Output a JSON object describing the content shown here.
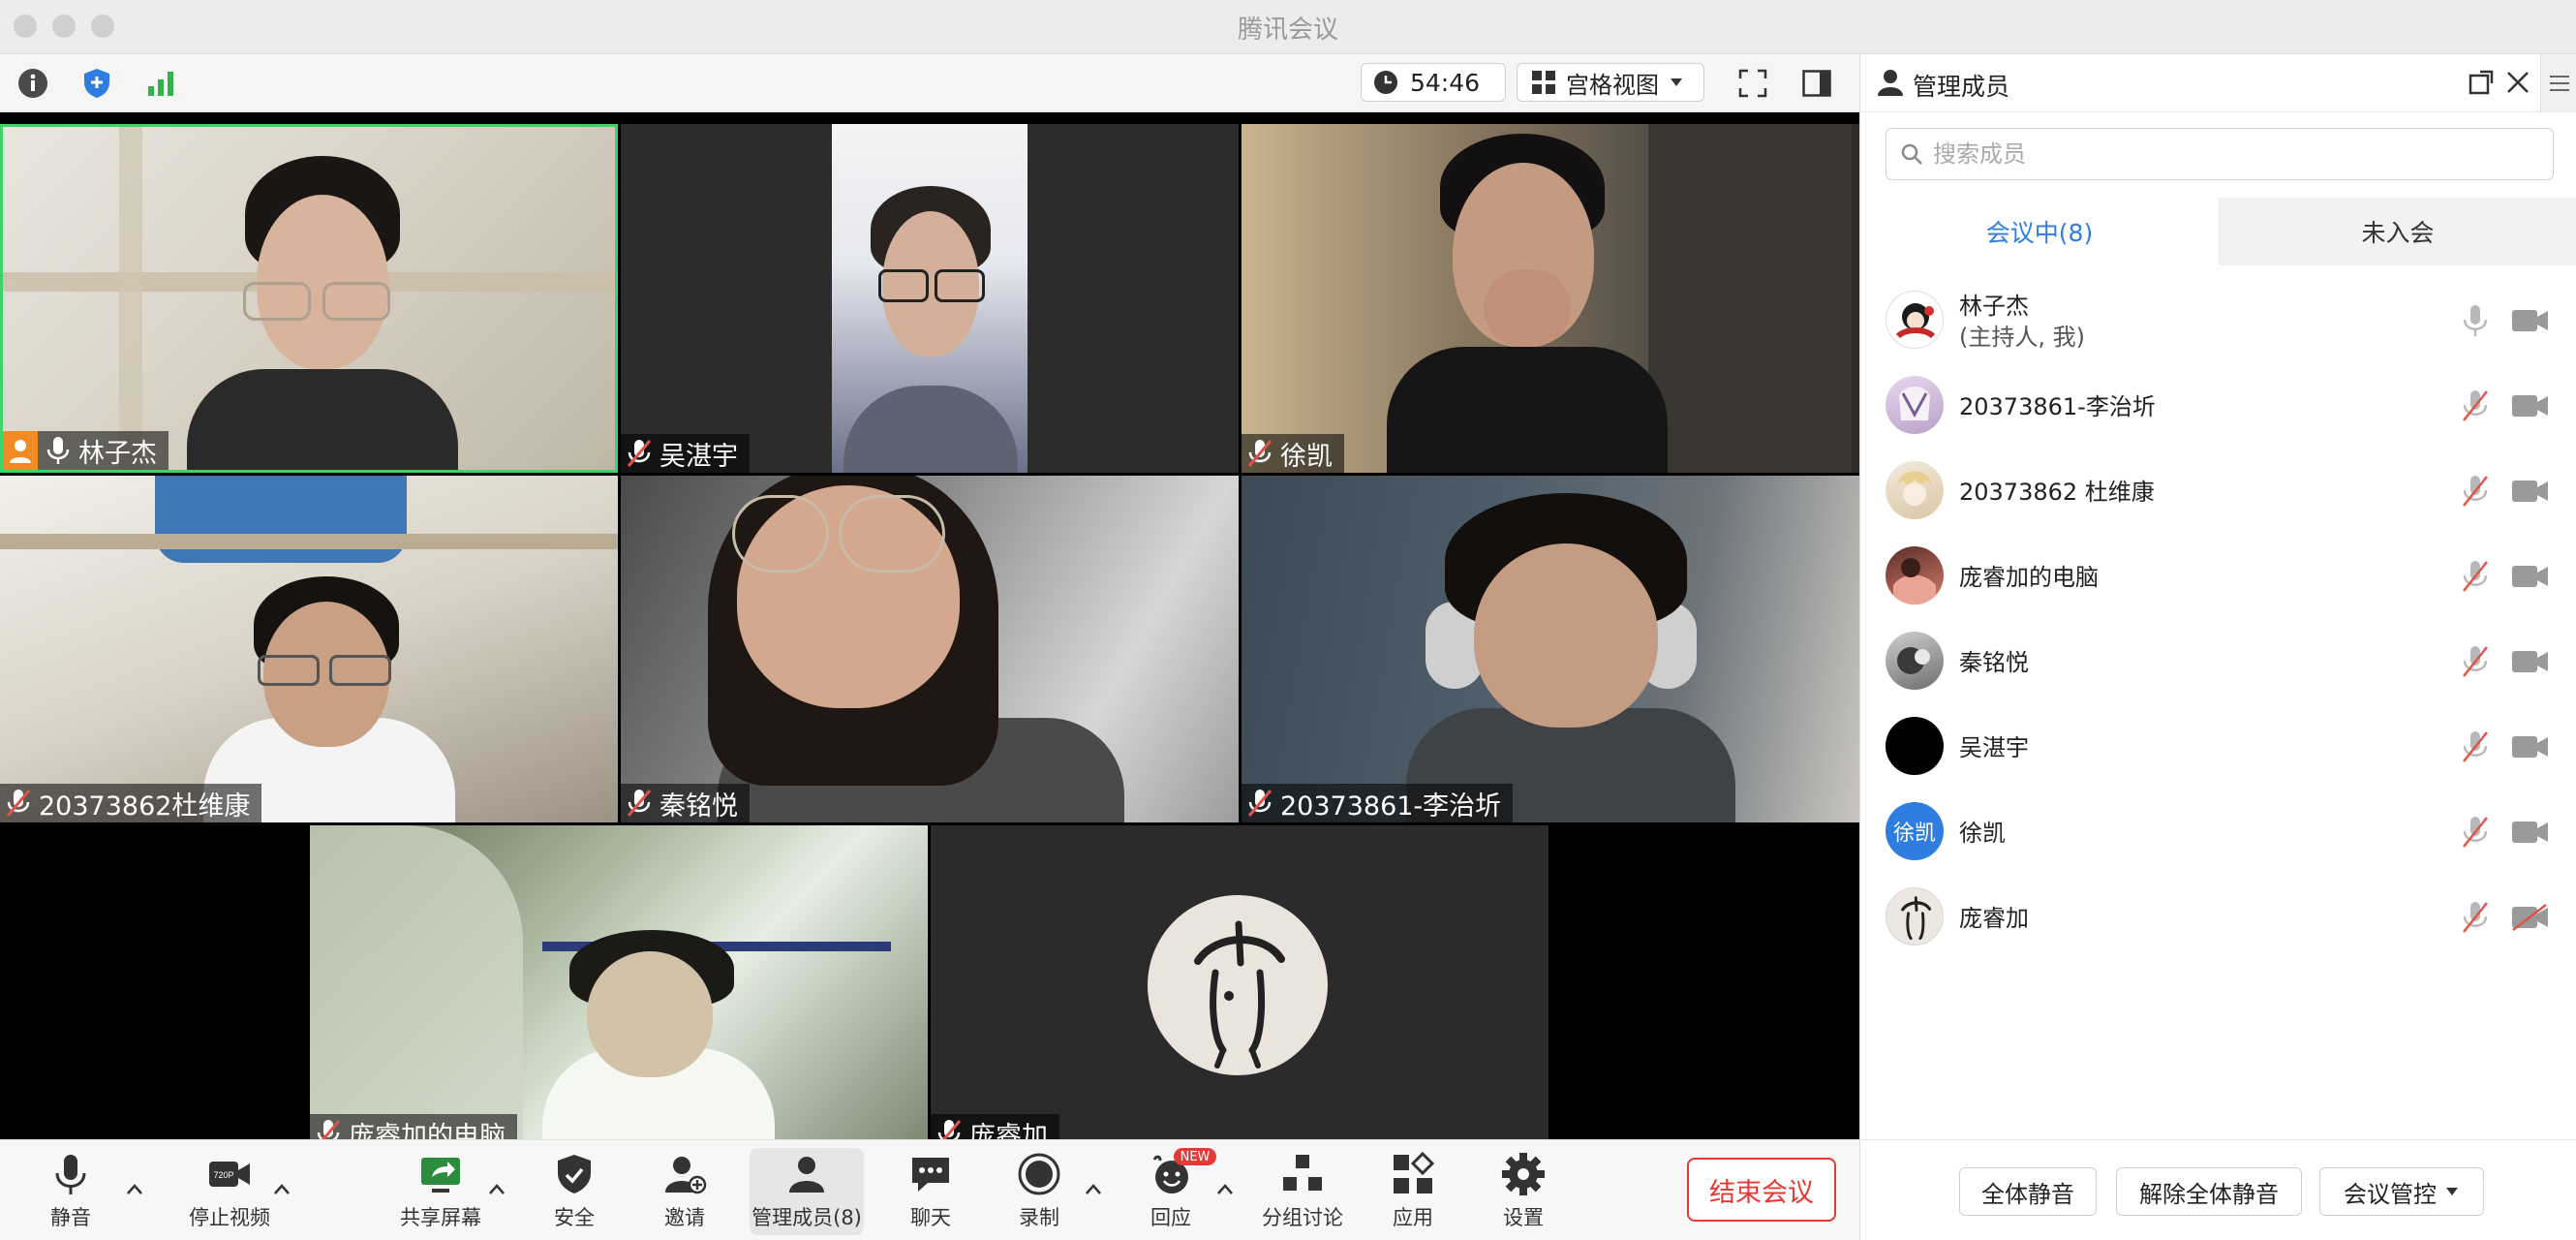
{
  "window": {
    "title": "腾讯会议"
  },
  "topbar": {
    "timer": "54:46",
    "view_mode": "宫格视图"
  },
  "tiles": [
    {
      "name": "林子杰",
      "muted": false,
      "host": true,
      "speaking": true
    },
    {
      "name": "吴湛宇",
      "muted": true
    },
    {
      "name": "徐凯",
      "muted": true
    },
    {
      "name": "20373862杜维康",
      "muted": true
    },
    {
      "name": "秦铭悦",
      "muted": true
    },
    {
      "name": "20373861-李治圻",
      "muted": true
    },
    {
      "name": "庞睿加的电脑",
      "muted": true
    },
    {
      "name": "庞睿加",
      "muted": true
    }
  ],
  "toolbar": {
    "mute": "静音",
    "stop_video": "停止视频",
    "video_badge": "720P",
    "share_screen": "共享屏幕",
    "security": "安全",
    "invite": "邀请",
    "manage_members": "管理成员(8)",
    "chat": "聊天",
    "record": "录制",
    "react": "回应",
    "react_badge": "NEW",
    "breakout": "分组讨论",
    "apps": "应用",
    "settings": "设置",
    "end_meeting": "结束会议"
  },
  "panel": {
    "title": "管理成员",
    "search_placeholder": "搜索成员",
    "tab_in_meeting": "会议中(8)",
    "tab_not_joined": "未入会",
    "members": [
      {
        "name": "林子杰",
        "sub": "(主持人, 我)",
        "mic": "on",
        "cam": "on"
      },
      {
        "name": "20373861-李治圻",
        "mic": "off",
        "cam": "on"
      },
      {
        "name": "20373862 杜维康",
        "mic": "off",
        "cam": "on"
      },
      {
        "name": "庞睿加的电脑",
        "mic": "off",
        "cam": "on"
      },
      {
        "name": "秦铭悦",
        "mic": "off",
        "cam": "on"
      },
      {
        "name": "吴湛宇",
        "mic": "off",
        "cam": "on"
      },
      {
        "name": "徐凯",
        "avatar_text": "徐凯",
        "mic": "off",
        "cam": "on"
      },
      {
        "name": "庞睿加",
        "mic": "off",
        "cam": "off"
      }
    ],
    "mute_all": "全体静音",
    "unmute_all": "解除全体静音",
    "meeting_control": "会议管控"
  },
  "colors": {
    "accent_blue": "#2f7de1",
    "end_red": "#e53935",
    "speaking_green": "#3fd26b",
    "host_orange": "#f08a24",
    "muted_red": "#e0534a"
  }
}
